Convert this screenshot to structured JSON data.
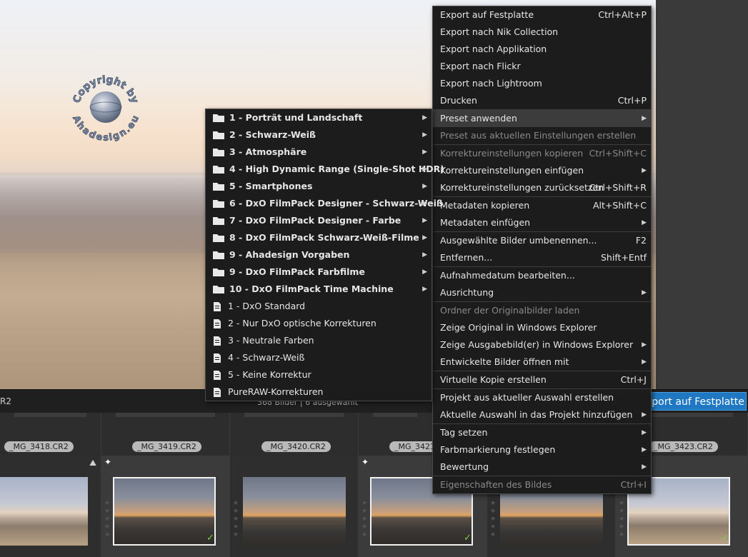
{
  "context_menu": {
    "items": [
      {
        "label": "Export auf Festplatte",
        "shortcut": "Ctrl+Alt+P"
      },
      {
        "label": "Export nach Nik Collection"
      },
      {
        "label": "Export nach Applikation"
      },
      {
        "label": "Export nach Flickr"
      },
      {
        "label": "Export nach Lightroom"
      },
      {
        "label": "Drucken",
        "shortcut": "Ctrl+P"
      },
      {
        "label": "Preset anwenden"
      },
      {
        "label": "Preset aus aktuellen Einstellungen erstellen"
      },
      {
        "label": "Korrektureinstellungen kopieren",
        "shortcut": "Ctrl+Shift+C"
      },
      {
        "label": "Korrektureinstellungen einfügen"
      },
      {
        "label": "Korrektureinstellungen zurücksetzen",
        "shortcut": "Ctrl+Shift+R"
      },
      {
        "label": "Metadaten kopieren",
        "shortcut": "Alt+Shift+C"
      },
      {
        "label": "Metadaten einfügen"
      },
      {
        "label": "Ausgewählte Bilder umbenennen...",
        "shortcut": "F2"
      },
      {
        "label": "Entfernen...",
        "shortcut": "Shift+Entf"
      },
      {
        "label": "Aufnahmedatum bearbeiten..."
      },
      {
        "label": "Ausrichtung"
      },
      {
        "label": "Ordner der Originalbilder laden"
      },
      {
        "label": "Zeige Original in Windows Explorer"
      },
      {
        "label": "Zeige Ausgabebild(er) in Windows Explorer"
      },
      {
        "label": "Entwickelte Bilder öffnen mit"
      },
      {
        "label": "Virtuelle Kopie erstellen",
        "shortcut": "Ctrl+J"
      },
      {
        "label": "Projekt aus aktueller Auswahl erstellen"
      },
      {
        "label": "Aktuelle Auswahl in das Projekt hinzufügen"
      },
      {
        "label": "Tag setzen"
      },
      {
        "label": "Farbmarkierung festlegen"
      },
      {
        "label": "Bewertung"
      },
      {
        "label": "Eigenschaften des Bildes",
        "shortcut": "Ctrl+I"
      }
    ]
  },
  "preset_menu": {
    "folders": [
      "1 - Porträt und Landschaft",
      "2 - Schwarz-Weiß",
      "3 - Atmosphäre",
      "4 - High Dynamic Range (Single-Shot HDR)",
      "5 - Smartphones",
      "6 - DxO FilmPack Designer - Schwarz-Weiß",
      "7 - DxO FilmPack Designer - Farbe",
      "8 - DxO FilmPack Schwarz-Weiß-Filme",
      "9 - Ahadesign Vorgaben",
      "9 - DxO FilmPack Farbfilme",
      "10 - DxO FilmPack Time Machine"
    ],
    "presets": [
      "1 - DxO Standard",
      "2 - Nur DxO optische Korrekturen",
      "3 - Neutrale Farben",
      "4 - Schwarz-Weiß",
      "5 - Keine Korrektur",
      "PureRAW-Korrekturen"
    ]
  },
  "watermark": {
    "top": "Copyright by",
    "bottom": "Ahadesign.eu"
  },
  "status": {
    "left": "R2",
    "count": "368 Bilder | 6 ausgewählt",
    "export_button": "xport auf Festplatte"
  },
  "filmstrip": {
    "names": [
      "_MG_3418.CR2",
      "_MG_3419.CR2",
      "_MG_3420.CR2",
      "_MG_3421",
      "_MG_3423.CR2"
    ]
  },
  "colors": {
    "accent": "#1f78c1",
    "check": "#7ad23a",
    "menu_bg": "#1c1c1c"
  }
}
